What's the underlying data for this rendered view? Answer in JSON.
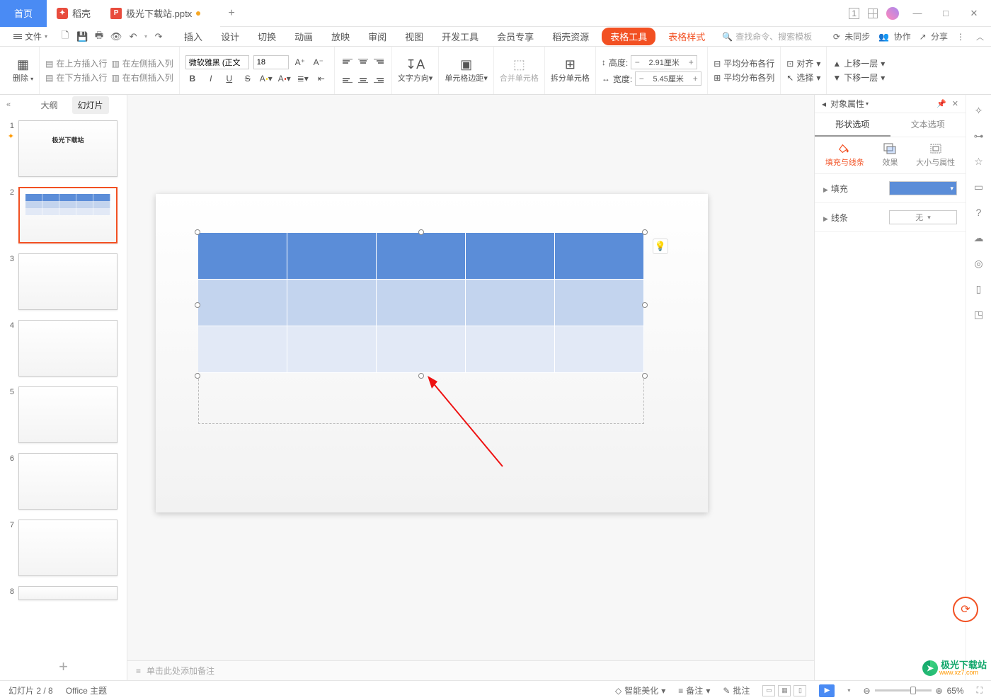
{
  "titlebar": {
    "home": "首页",
    "docker": "稻壳",
    "doc_name": "极光下载站.pptx"
  },
  "menubar": {
    "file": "文件",
    "tabs": [
      "插入",
      "设计",
      "切换",
      "动画",
      "放映",
      "审阅",
      "视图",
      "开发工具",
      "会员专享",
      "稻壳资源"
    ],
    "active_tool": "表格工具",
    "template_style": "表格样式",
    "search_placeholder": "查找命令、搜索模板",
    "right": {
      "unsync": "未同步",
      "coop": "协作",
      "share": "分享"
    }
  },
  "ribbon": {
    "delete": "删除",
    "ins_above": "在上方插入行",
    "ins_below": "在下方插入行",
    "ins_left": "在左侧插入列",
    "ins_right": "在右侧插入列",
    "font_name": "微软雅黑 (正文",
    "font_size": "18",
    "text_dir": "文字方向",
    "cell_margin": "单元格边距",
    "merge": "合并单元格",
    "split": "拆分单元格",
    "height_lbl": "高度:",
    "height_val": "2.91厘米",
    "width_lbl": "宽度:",
    "width_val": "5.45厘米",
    "dist_rows": "平均分布各行",
    "dist_cols": "平均分布各列",
    "align": "对齐",
    "select": "选择",
    "move_up": "上移一层",
    "move_down": "下移一层"
  },
  "thumb_tabs": {
    "outline": "大纲",
    "slides": "幻灯片"
  },
  "slide1_title": "极光下载站",
  "notes_placeholder": "单击此处添加备注",
  "right_panel": {
    "title": "对象属性",
    "tab_shape": "形状选项",
    "tab_text": "文本选项",
    "sub_fill": "填充与线条",
    "sub_effect": "效果",
    "sub_size": "大小与属性",
    "sec_fill": "填充",
    "sec_line": "线条",
    "line_none": "无"
  },
  "status": {
    "slide_of": "幻灯片 2 / 8",
    "theme": "Office 主题",
    "beautify": "智能美化",
    "notes": "备注",
    "comments": "批注",
    "zoom": "65%"
  },
  "watermark": {
    "text": "极光下载站",
    "url": "www.xz7.com"
  }
}
